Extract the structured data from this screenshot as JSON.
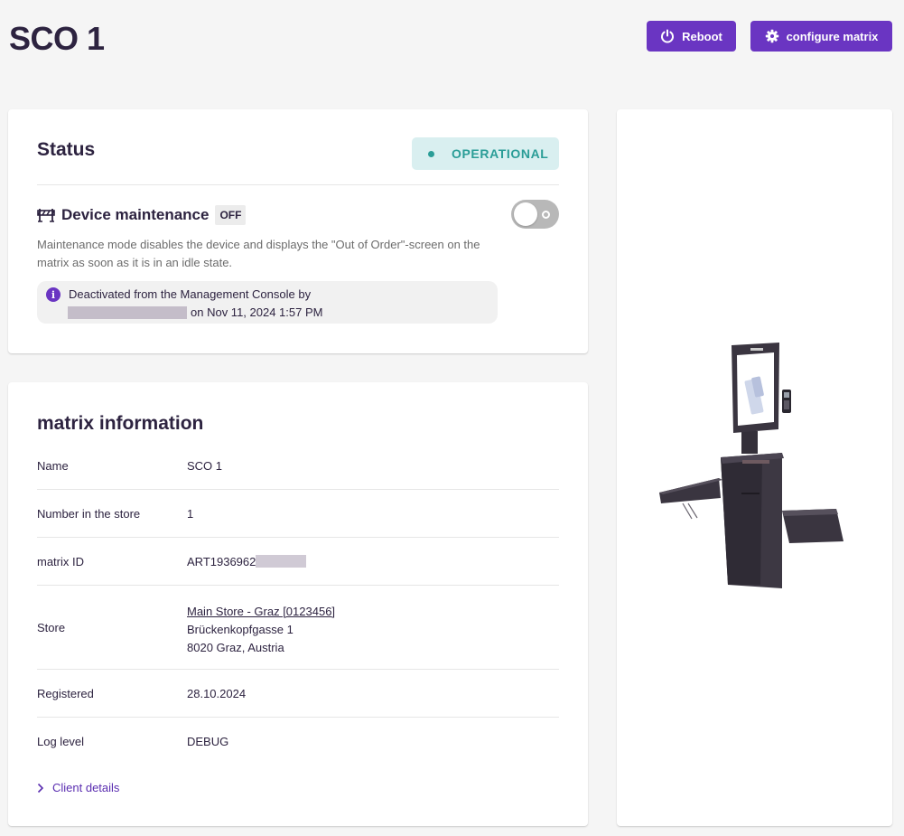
{
  "header": {
    "title": "SCO 1",
    "reboot_label": "Reboot",
    "configure_label": "configure matrix"
  },
  "status": {
    "title": "Status",
    "badge": "OPERATIONAL",
    "badge_color": "#2a9d97",
    "maintenance": {
      "label": "Device maintenance",
      "state": "OFF",
      "enabled": false,
      "description": "Maintenance mode disables the device and displays the \"Out of Order\"-screen on the matrix as soon as it is in an idle state.",
      "info_line1": "Deactivated from the Management Console by",
      "info_line2": "on Nov 11, 2024 1:57 PM"
    }
  },
  "info": {
    "title": "matrix information",
    "rows": [
      {
        "label": "Name",
        "value": "SCO 1"
      },
      {
        "label": "Number in the store",
        "value": "1"
      },
      {
        "label": "matrix ID",
        "value": "ART1936962"
      },
      {
        "label": "Store",
        "link": "Main Store - Graz [0123456]",
        "line2": "Brückenkopfgasse 1",
        "line3": "8020 Graz, Austria"
      },
      {
        "label": "Registered",
        "value": "28.10.2024"
      },
      {
        "label": "Log level",
        "value": "DEBUG"
      }
    ],
    "client_details_label": "Client details"
  },
  "colors": {
    "accent": "#6a35c2",
    "text": "#2d2340",
    "badge_bg": "#d9eff0"
  },
  "icons": {
    "reboot": "power-icon",
    "configure": "gear-icon",
    "maintenance": "barrier-icon",
    "info": "info-icon",
    "client_details": "chevron-right-icon"
  }
}
